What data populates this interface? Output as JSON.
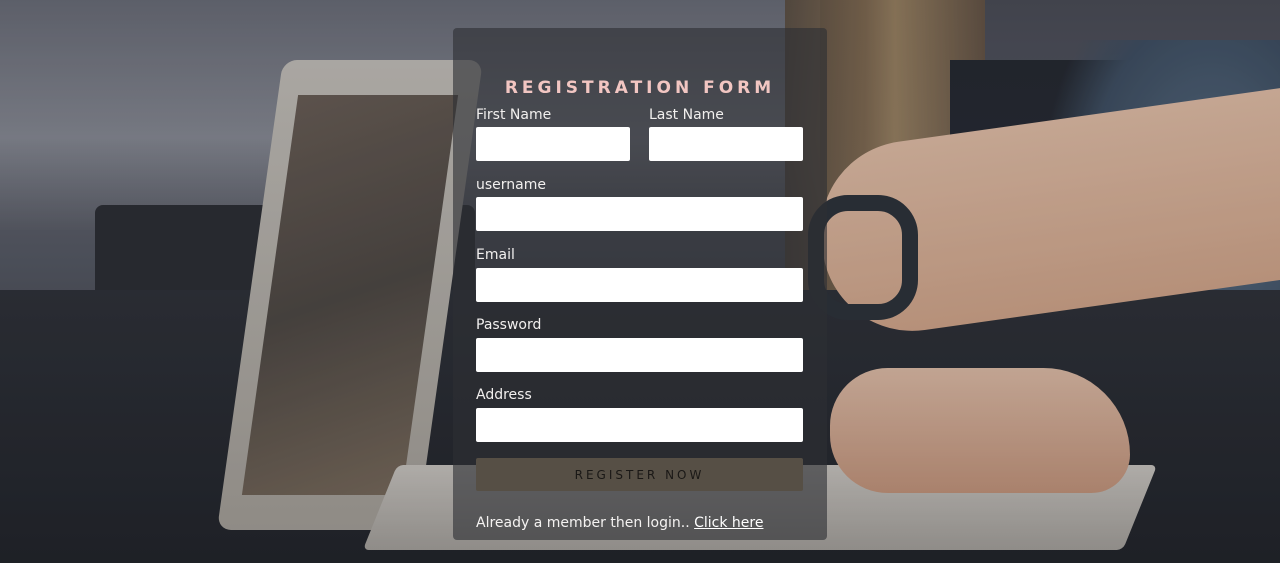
{
  "form": {
    "title": "REGISTRATION FORM",
    "first_name_label": "First Name",
    "last_name_label": "Last Name",
    "username_label": "username",
    "email_label": "Email",
    "password_label": "Password",
    "address_label": "Address",
    "first_name_value": "",
    "last_name_value": "",
    "username_value": "",
    "email_value": "",
    "password_value": "",
    "address_value": "",
    "register_label": "REGISTER NOW"
  },
  "footer": {
    "prompt": "Already a member then login.. ",
    "link": "Click here"
  },
  "colors": {
    "title": "#f2c6c2",
    "button_bg": "#564f45",
    "panel_bg": "rgba(45,46,52,0.62)"
  }
}
